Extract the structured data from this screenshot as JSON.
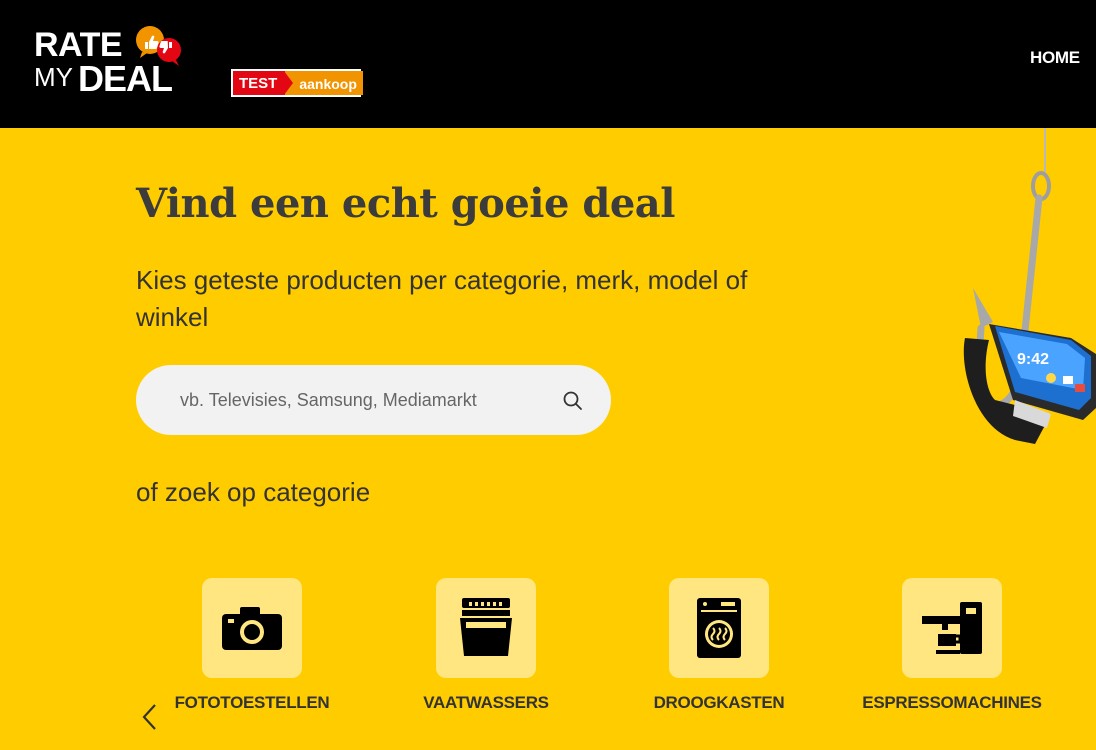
{
  "header": {
    "logo": {
      "line1": "RATE",
      "line2a": "MY",
      "line2b": "DEAL"
    },
    "partner": {
      "part1": "TEST",
      "part2": "aankoop"
    },
    "nav": {
      "home_label": "HOME"
    }
  },
  "hero": {
    "title": "Vind een echt goeie deal",
    "subtitle": "Kies geteste producten per categorie, merk, model of winkel",
    "search": {
      "placeholder": "vb. Televisies, Samsung, Mediamarkt",
      "value": "",
      "icon": "search-icon"
    },
    "category_prompt": "of zoek op categorie"
  },
  "categories": [
    {
      "label": "FOTOTOESTELLEN",
      "icon": "camera-icon"
    },
    {
      "label": "VAATWASSERS",
      "icon": "dishwasher-icon"
    },
    {
      "label": "DROOGKASTEN",
      "icon": "dryer-icon"
    },
    {
      "label": "ESPRESSOMACHINES",
      "icon": "espresso-machine-icon"
    }
  ],
  "carousel": {
    "prev_icon": "chevron-left-icon"
  },
  "colors": {
    "brand_yellow": "#ffcc00",
    "tile_bg": "#ffe680",
    "header_bg": "#000000",
    "test_red": "#e30613",
    "aankoop_orange": "#f29400"
  }
}
